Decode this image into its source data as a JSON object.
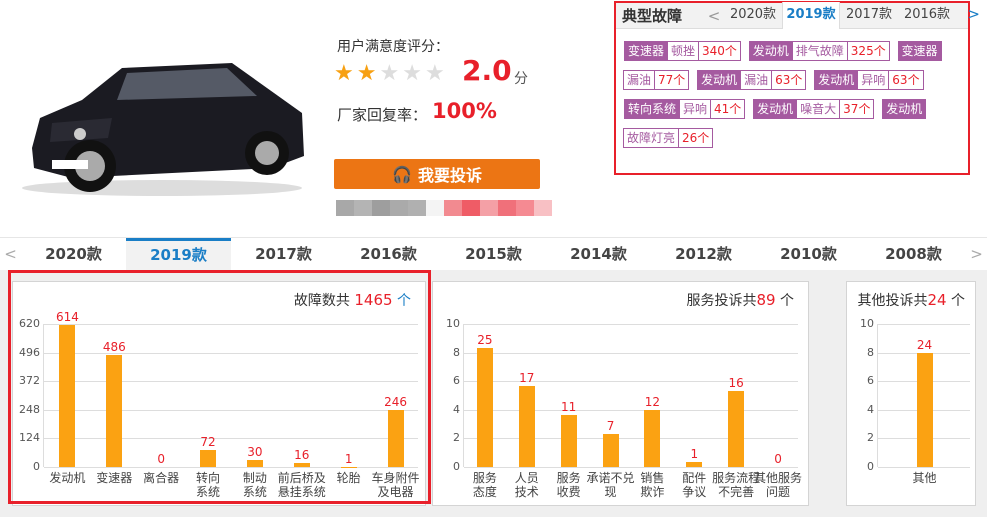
{
  "summary": {
    "rating_label": "用户满意度评分：",
    "stars_filled": 2,
    "stars_total": 5,
    "score": "2.0",
    "score_unit": "分",
    "reply_label": "厂家回复率：",
    "reply_rate": "100%",
    "complain_button": "我要投诉"
  },
  "typical_faults": {
    "title": "典型故障",
    "prev": "<",
    "next": ">",
    "tabs": [
      "2020款",
      "2019款",
      "2017款",
      "2016款"
    ],
    "active_tab": 1,
    "tags": [
      {
        "cat": "变速器",
        "issue": "顿挫",
        "count": "340个"
      },
      {
        "cat": "发动机",
        "issue": "排气故障",
        "count": "325个"
      },
      {
        "cat": "变速器",
        "issue": "漏油",
        "count": "77个"
      },
      {
        "cat": "发动机",
        "issue": "漏油",
        "count": "63个"
      },
      {
        "cat": "发动机",
        "issue": "异响",
        "count": "63个"
      },
      {
        "cat": "转向系统",
        "issue": "异响",
        "count": "41个"
      },
      {
        "cat": "发动机",
        "issue": "噪音大",
        "count": "37个"
      },
      {
        "cat": "发动机",
        "issue": "故障灯亮",
        "count": "26个"
      }
    ]
  },
  "year_tabs": {
    "prev": "<",
    "next": ">",
    "items": [
      "2020款",
      "2019款",
      "2017款",
      "2016款",
      "2015款",
      "2014款",
      "2012款",
      "2010款",
      "2008款"
    ],
    "active": 1
  },
  "panels": {
    "faults": {
      "prefix": "故障数共",
      "total": "1465",
      "suffix": "个"
    },
    "service": {
      "prefix": "服务投诉共",
      "total": "89",
      "suffix": "个"
    },
    "other": {
      "prefix": "其他投诉共",
      "total": "24",
      "suffix": "个"
    }
  },
  "chart_data": [
    {
      "type": "bar",
      "title": "故障数共 1465 个",
      "categories": [
        "发动机",
        "变速器",
        "离合器",
        "转向\n系统",
        "制动\n系统",
        "前后桥及\n悬挂系统",
        "轮胎",
        "车身附件\n及电器"
      ],
      "values": [
        614,
        486,
        0,
        72,
        30,
        16,
        1,
        246
      ],
      "yticks": [
        "0",
        "124",
        "248",
        "372",
        "496",
        "620"
      ],
      "ylim": [
        0,
        620
      ],
      "grid": true
    },
    {
      "type": "bar",
      "title": "服务投诉共 89 个",
      "categories": [
        "服务\n态度",
        "人员\n技术",
        "服务\n收费",
        "承诺不兑\n现",
        "销售\n欺诈",
        "配件\n争议",
        "服务流程\n不完善",
        "其他服务\n问题"
      ],
      "values": [
        25,
        17,
        11,
        7,
        12,
        1,
        16,
        0
      ],
      "yticks": [
        "0",
        "2",
        "4",
        "6",
        "8",
        "10"
      ],
      "ylim": [
        0,
        30
      ],
      "grid": true
    },
    {
      "type": "bar",
      "title": "其他投诉共 24 个",
      "categories": [
        "其他"
      ],
      "values": [
        24
      ],
      "yticks": [
        "0",
        "2",
        "4",
        "6",
        "8",
        "10"
      ],
      "ylim": [
        0,
        30
      ],
      "grid": true
    }
  ]
}
